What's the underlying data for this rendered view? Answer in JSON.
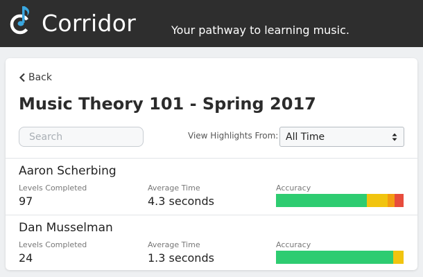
{
  "header": {
    "brand": "Corridor",
    "tagline": "Your pathway to learning music.",
    "logo_icon": "music-note-icon",
    "logo_colors": {
      "note": "#ffffff",
      "accent": "#3aa7e0"
    }
  },
  "page": {
    "back_label": "Back",
    "back_icon": "chevron-left-icon",
    "title": "Music Theory 101 - Spring 2017",
    "search_placeholder": "Search",
    "search_value": "",
    "highlights_label": "View Highlights From:",
    "highlights_selected": "All Time",
    "highlights_icon": "select-arrows-icon"
  },
  "columns": {
    "levels": "Levels Completed",
    "time": "Average Time",
    "accuracy": "Accuracy"
  },
  "accuracy_colors": {
    "correct": "#2ecc71",
    "partial": "#f1c40f",
    "warn": "#f39c12",
    "wrong": "#e74c3c"
  },
  "students": [
    {
      "name": "Aaron Scherbing",
      "levels": "97",
      "time": "4.3 seconds",
      "accuracy": [
        {
          "kind": "correct",
          "fraction": 0.712
        },
        {
          "kind": "partial",
          "fraction": 0.163
        },
        {
          "kind": "warn",
          "fraction": 0.054
        },
        {
          "kind": "wrong",
          "fraction": 0.071
        }
      ]
    },
    {
      "name": "Dan Musselman",
      "levels": "24",
      "time": "1.3 seconds",
      "accuracy": [
        {
          "kind": "correct",
          "fraction": 0.918
        },
        {
          "kind": "partial",
          "fraction": 0.082
        }
      ]
    }
  ]
}
